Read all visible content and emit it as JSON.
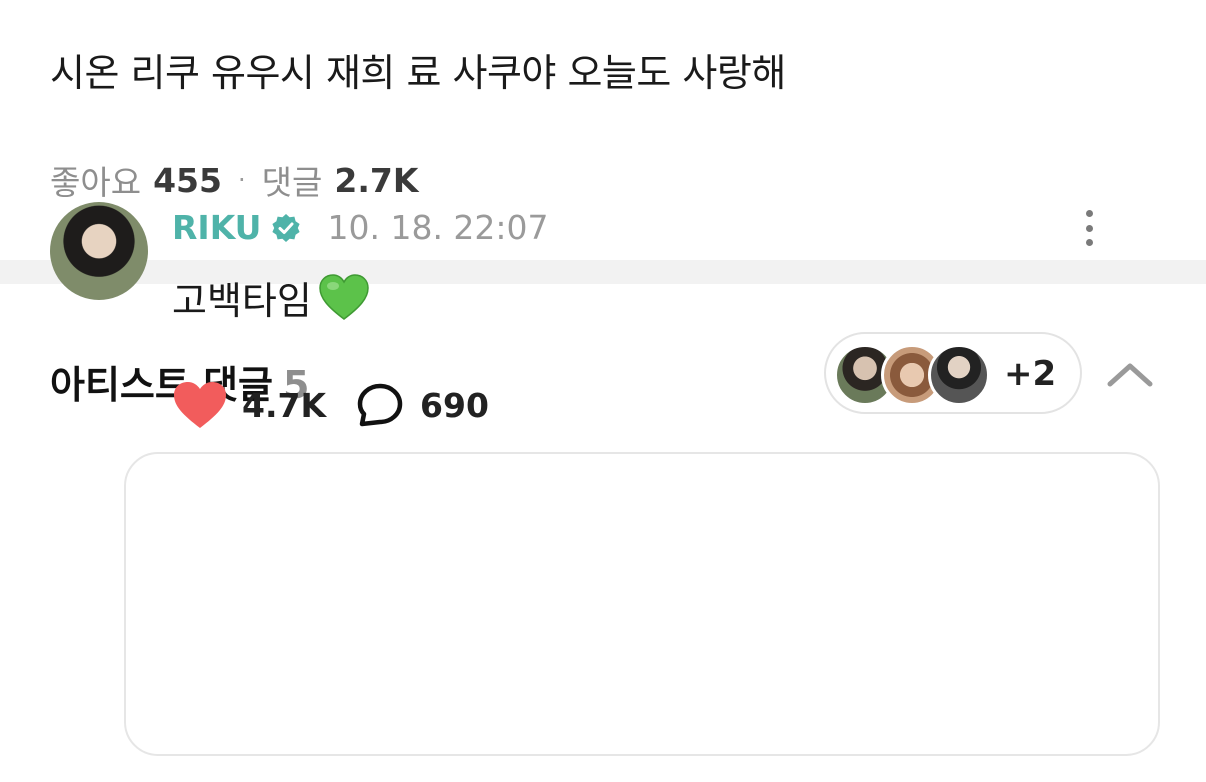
{
  "post": {
    "body": "시온 리쿠 유우시 재희 료 사쿠야 오늘도 사랑해",
    "likes_label": "좋아요",
    "likes_count": "455",
    "separator": "·",
    "comments_label": "댓글",
    "comments_count": "2.7K"
  },
  "artist_comments": {
    "title": "아티스트 댓글",
    "count": "5",
    "more_avatars": "+2",
    "comment": {
      "author": "RIKU",
      "timestamp": "10. 18. 22:07",
      "text": "고백타임",
      "likes": "4.7K",
      "replies": "690"
    }
  },
  "colors": {
    "author_accent": "#4fb3a9",
    "verified_badge": "#4fb3a9",
    "like_heart": "#f25c5c",
    "green_heart": "#5cc24a"
  },
  "icons": {
    "verified": "verified-badge-icon",
    "more": "more-vertical-icon",
    "collapse": "chevron-up-icon",
    "like": "heart-icon",
    "reply": "speech-bubble-icon",
    "emoji": "green-heart-emoji"
  }
}
